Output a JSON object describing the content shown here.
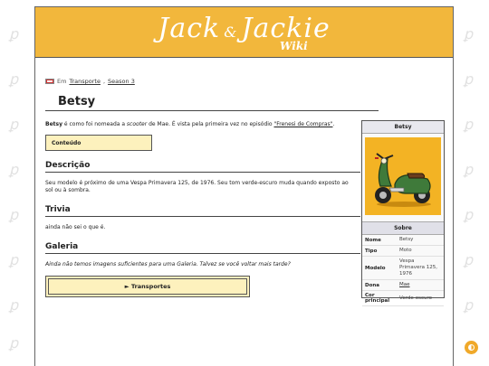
{
  "site": {
    "logo_text": "Jack",
    "logo_amp": "&",
    "logo_text2": "Jackie",
    "logo_sub": "Wiki"
  },
  "breadcrumb": {
    "prefix": "Em",
    "category": "Transporte",
    "separator": ",",
    "season": "Season 3"
  },
  "page": {
    "title": "Betsy",
    "intro_bold": "Betsy",
    "intro_1": " é como foi nomeada a ",
    "intro_italic": "scooter",
    "intro_2": " de Mae. É vista pela primeira vez no episódio ",
    "intro_link": "\"Frenesi de Compras\"",
    "intro_end": "."
  },
  "toc": {
    "label": "Conteúdo"
  },
  "sections": {
    "descricao_title": "Descrição",
    "descricao_text": "Seu modelo é próximo de uma Vespa Primavera 125, de 1976. Seu tom verde-escuro muda quando exposto ao sol ou à sombra.",
    "trivia_title": "Trivia",
    "trivia_text": "ainda não sei o que é.",
    "galeria_title": "Galeria",
    "galeria_text": "Ainda não temos imagens suficientes para uma Galeria. Talvez se você voltar mais tarde?"
  },
  "nav_box": {
    "label": "► Transportes"
  },
  "infobox": {
    "title": "Betsy",
    "image_icon": "scooter-image",
    "about_label": "Sobre",
    "rows": [
      {
        "key": "Nome",
        "value": "Betsy"
      },
      {
        "key": "Tipo",
        "value": "Moto"
      },
      {
        "key": "Modelo",
        "value": "Vespa Primavera 125, 1976"
      },
      {
        "key": "Dona",
        "value": "Mae"
      },
      {
        "key": "Cor principal",
        "value": "Verde-escuro"
      }
    ]
  },
  "colors": {
    "banner": "#f2b73c",
    "toc_bg": "#fdf1bd",
    "scooter_bg": "#f3b324",
    "scooter_body": "#3f7a3a"
  },
  "theme_toggle_icon": "contrast-icon"
}
